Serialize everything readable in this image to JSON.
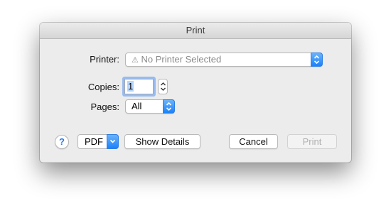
{
  "window": {
    "title": "Print"
  },
  "printer": {
    "label": "Printer:",
    "selected": "No Printer Selected",
    "warning_icon": "warning-icon"
  },
  "copies": {
    "label": "Copies:",
    "value": "1"
  },
  "pages": {
    "label": "Pages:",
    "selected": "All"
  },
  "footer": {
    "help_label": "?",
    "pdf_label": "PDF",
    "show_details_label": "Show Details",
    "cancel_label": "Cancel",
    "print_label": "Print"
  },
  "colors": {
    "accent": "#1a82fb",
    "dialog_bg": "#ececec",
    "focus_ring": "#5096f5"
  }
}
